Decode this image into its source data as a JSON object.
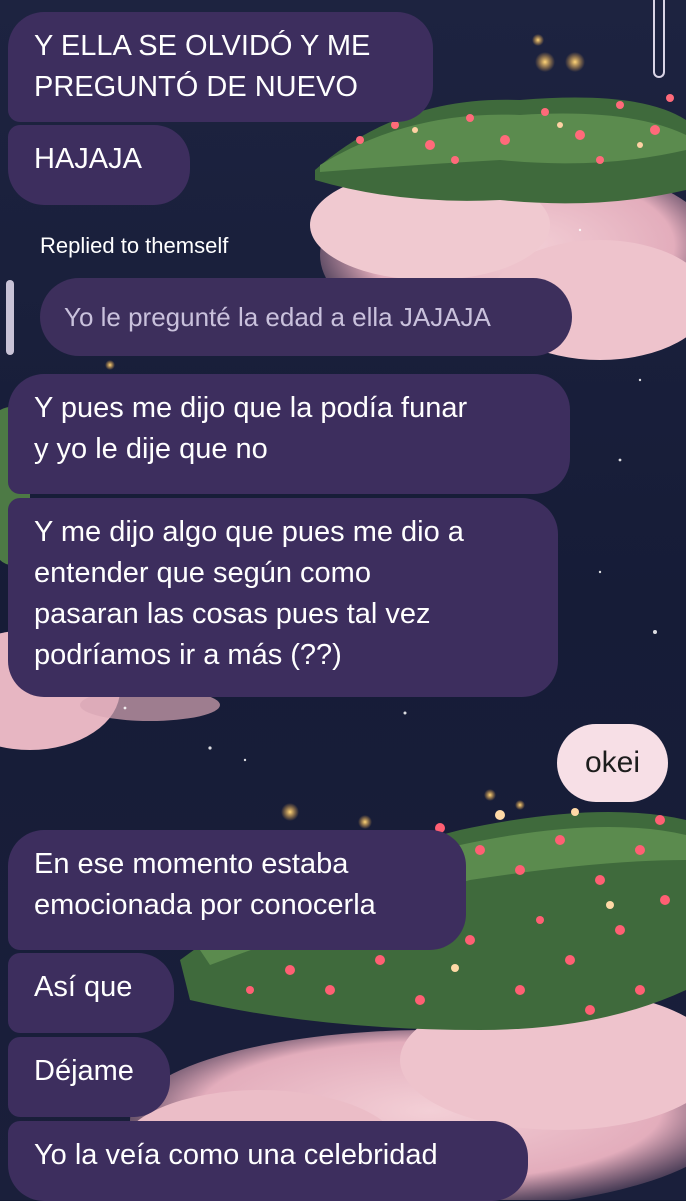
{
  "reply": {
    "label": "Replied to themself",
    "quoted_text": "Yo le pregunté la edad a ella JAJAJA"
  },
  "messages": [
    {
      "id": "m1",
      "lines": [
        "Y ELLA SE OLVIDÓ Y ME",
        "PREGUNTÓ DE NUEVO"
      ]
    },
    {
      "id": "m2",
      "lines": [
        "HAJAJA"
      ]
    },
    {
      "id": "m3",
      "lines": [
        "Y pues me dijo que la podía funar",
        "y yo le dije que no"
      ]
    },
    {
      "id": "m4",
      "lines": [
        "Y me dijo algo que pues me dio a",
        "entender que según como",
        "pasaran las cosas pues tal vez",
        "podríamos ir a más (??)"
      ]
    },
    {
      "id": "m5",
      "lines": [
        "okei"
      ]
    },
    {
      "id": "m6",
      "lines": [
        "En ese momento estaba",
        "emocionada por conocerla"
      ]
    },
    {
      "id": "m7",
      "lines": [
        "Así que"
      ]
    },
    {
      "id": "m8",
      "lines": [
        "Déjame"
      ]
    },
    {
      "id": "m9",
      "lines": [
        "Yo la veía como una celebridad"
      ]
    }
  ],
  "colors": {
    "sent_bubble": "#3d2e5e",
    "received_bubble": "#f7dfe6",
    "background": "#141a33"
  }
}
